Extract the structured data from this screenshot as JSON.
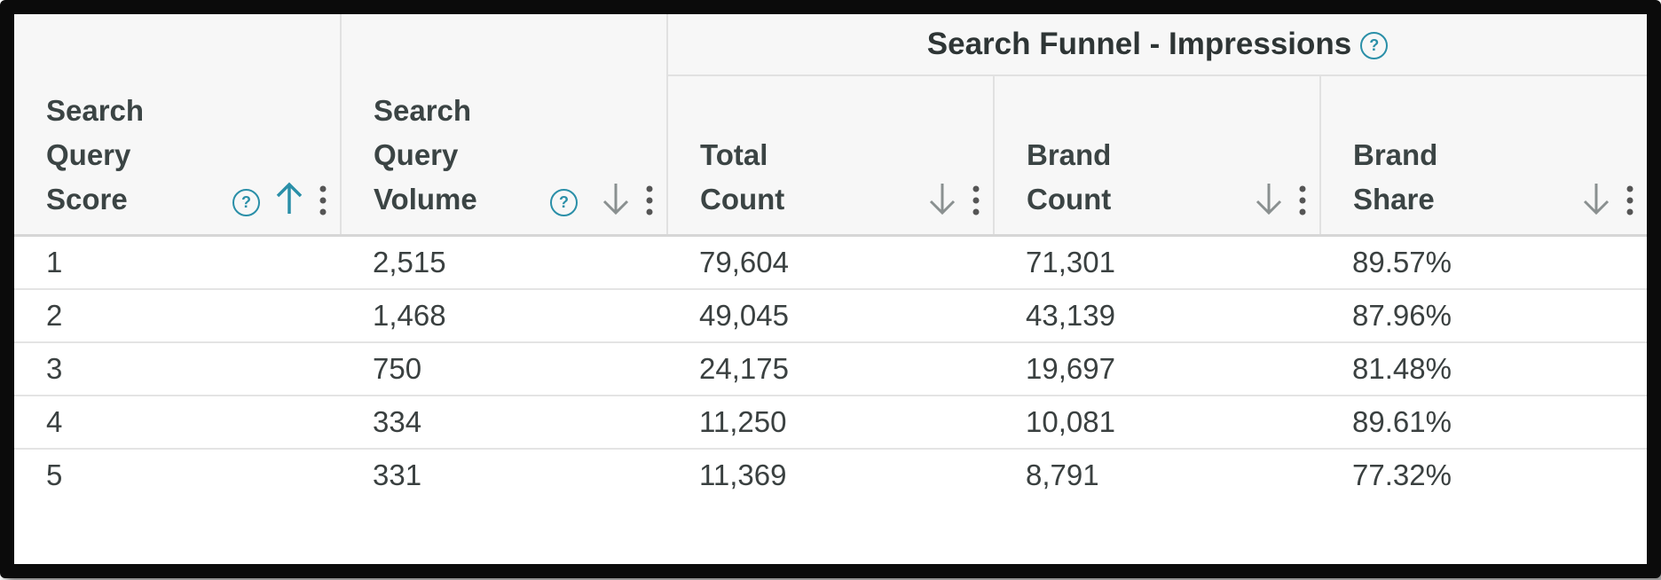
{
  "group_header": {
    "label": "Search Funnel - Impressions",
    "help_icon": "help-circle-icon"
  },
  "columns": [
    {
      "label": "Search\nQuery\nScore",
      "help": true,
      "sort": "ascending",
      "sort_icon": "arrow-up-icon",
      "menu_icon": "kebab-menu-icon"
    },
    {
      "label": "Search\nQuery\nVolume",
      "help": true,
      "sort": "descending",
      "sort_icon": "arrow-down-icon",
      "menu_icon": "kebab-menu-icon"
    },
    {
      "label": "Total\nCount",
      "help": false,
      "sort": "descending",
      "sort_icon": "arrow-down-icon",
      "menu_icon": "kebab-menu-icon"
    },
    {
      "label": "Brand\nCount",
      "help": false,
      "sort": "descending",
      "sort_icon": "arrow-down-icon",
      "menu_icon": "kebab-menu-icon"
    },
    {
      "label": "Brand\nShare",
      "help": false,
      "sort": "descending",
      "sort_icon": "arrow-down-icon",
      "menu_icon": "kebab-menu-icon"
    }
  ],
  "rows": [
    [
      "1",
      "2,515",
      "79,604",
      "71,301",
      "89.57%"
    ],
    [
      "2",
      "1,468",
      "49,045",
      "43,139",
      "87.96%"
    ],
    [
      "3",
      "750",
      "24,175",
      "19,697",
      "81.48%"
    ],
    [
      "4",
      "334",
      "11,250",
      "10,081",
      "89.61%"
    ],
    [
      "5",
      "331",
      "11,369",
      "8,791",
      "77.32%"
    ]
  ],
  "colors": {
    "accent": "#2a8fa8",
    "header_bg": "#f7f7f7",
    "text": "#3a4040",
    "frame": "#0b0b0b"
  }
}
